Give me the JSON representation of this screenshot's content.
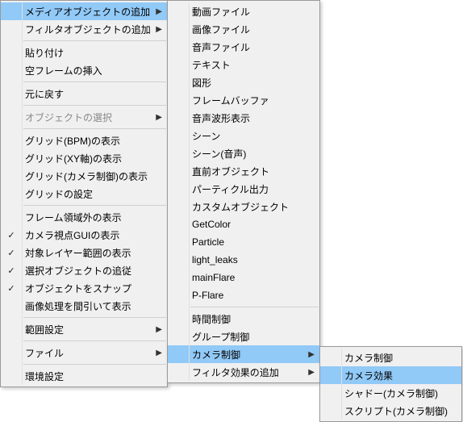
{
  "menu1": {
    "items": [
      {
        "label": "メディアオブジェクトの追加",
        "arrow": true,
        "highlighted": true
      },
      {
        "label": "フィルタオブジェクトの追加",
        "arrow": true
      },
      {
        "sep": true
      },
      {
        "label": "貼り付け"
      },
      {
        "label": "空フレームの挿入"
      },
      {
        "sep": true
      },
      {
        "label": "元に戻す"
      },
      {
        "sep": true
      },
      {
        "label": "オブジェクトの選択",
        "arrow": true,
        "disabled": true
      },
      {
        "sep": true
      },
      {
        "label": "グリッド(BPM)の表示"
      },
      {
        "label": "グリッド(XY軸)の表示"
      },
      {
        "label": "グリッド(カメラ制御)の表示"
      },
      {
        "label": "グリッドの設定"
      },
      {
        "sep": true
      },
      {
        "label": "フレーム領域外の表示"
      },
      {
        "label": "カメラ視点GUIの表示",
        "checked": true
      },
      {
        "label": "対象レイヤー範囲の表示",
        "checked": true
      },
      {
        "label": "選択オブジェクトの追従",
        "checked": true
      },
      {
        "label": "オブジェクトをスナップ",
        "checked": true
      },
      {
        "label": "画像処理を間引いて表示"
      },
      {
        "sep": true
      },
      {
        "label": "範囲設定",
        "arrow": true
      },
      {
        "sep": true
      },
      {
        "label": "ファイル",
        "arrow": true
      },
      {
        "sep": true
      },
      {
        "label": "環境設定"
      }
    ]
  },
  "menu2": {
    "items": [
      {
        "label": "動画ファイル"
      },
      {
        "label": "画像ファイル"
      },
      {
        "label": "音声ファイル"
      },
      {
        "label": "テキスト"
      },
      {
        "label": "図形"
      },
      {
        "label": "フレームバッファ"
      },
      {
        "label": "音声波形表示"
      },
      {
        "label": "シーン"
      },
      {
        "label": "シーン(音声)"
      },
      {
        "label": "直前オブジェクト"
      },
      {
        "label": "パーティクル出力"
      },
      {
        "label": "カスタムオブジェクト"
      },
      {
        "label": "GetColor"
      },
      {
        "label": "Particle"
      },
      {
        "label": "light_leaks"
      },
      {
        "label": "mainFlare"
      },
      {
        "label": "P-Flare"
      },
      {
        "sep": true
      },
      {
        "label": "時間制御"
      },
      {
        "label": "グループ制御"
      },
      {
        "label": "カメラ制御",
        "arrow": true,
        "highlighted": true
      },
      {
        "label": "フィルタ効果の追加",
        "arrow": true
      }
    ]
  },
  "menu3": {
    "items": [
      {
        "label": "カメラ制御"
      },
      {
        "label": "カメラ効果",
        "highlighted": true
      },
      {
        "label": "シャドー(カメラ制御)"
      },
      {
        "label": "スクリプト(カメラ制御)"
      }
    ]
  }
}
